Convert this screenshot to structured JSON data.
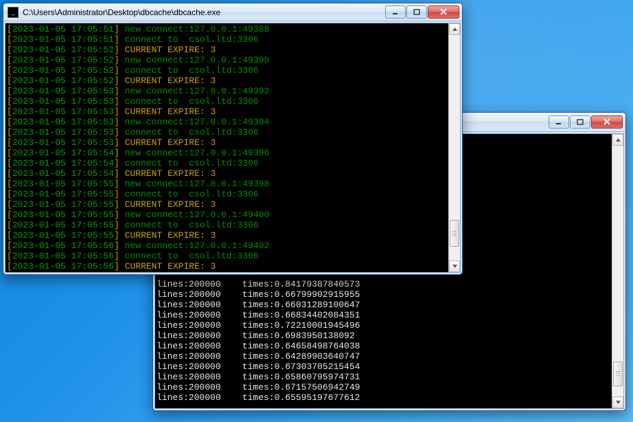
{
  "front_window": {
    "title": "C:\\Users\\Administrator\\Desktop\\dbcache\\dbcache.exe",
    "scroll": {
      "thumb_top_pct": 82,
      "thumb_height_pct": 12
    },
    "log": [
      {
        "ts": "2023-01-05 17:05:51",
        "msg": "new connect:127.0.0.1:49388",
        "style": "green"
      },
      {
        "ts": "2023-01-05 17:05:51",
        "msg": "connect to  csol.ltd:3306",
        "style": "green"
      },
      {
        "ts": "2023-01-05 17:05:52",
        "msg": "CURRENT EXPIRE: 3",
        "style": "yellow"
      },
      {
        "ts": "2023-01-05 17:05:52",
        "msg": "new connect:127.0.0.1:49390",
        "style": "green"
      },
      {
        "ts": "2023-01-05 17:05:52",
        "msg": "connect to  csol.ltd:3306",
        "style": "green"
      },
      {
        "ts": "2023-01-05 17:05:52",
        "msg": "CURRENT EXPIRE: 3",
        "style": "yellow"
      },
      {
        "ts": "2023-01-05 17:05:53",
        "msg": "new connect:127.0.0.1:49392",
        "style": "green"
      },
      {
        "ts": "2023-01-05 17:05:53",
        "msg": "connect to  csol.ltd:3306",
        "style": "green"
      },
      {
        "ts": "2023-01-05 17:05:53",
        "msg": "CURRENT EXPIRE: 3",
        "style": "yellow"
      },
      {
        "ts": "2023-01-05 17:05:53",
        "msg": "new connect:127.0.0.1:49394",
        "style": "green"
      },
      {
        "ts": "2023-01-05 17:05:53",
        "msg": "connect to  csol.ltd:3306",
        "style": "green"
      },
      {
        "ts": "2023-01-05 17:05:53",
        "msg": "CURRENT EXPIRE: 3",
        "style": "yellow"
      },
      {
        "ts": "2023-01-05 17:05:54",
        "msg": "new connect:127.0.0.1:49396",
        "style": "green"
      },
      {
        "ts": "2023-01-05 17:05:54",
        "msg": "connect to  csol.ltd:3306",
        "style": "green"
      },
      {
        "ts": "2023-01-05 17:05:54",
        "msg": "CURRENT EXPIRE: 3",
        "style": "yellow"
      },
      {
        "ts": "2023-01-05 17:05:55",
        "msg": "new connect:127.0.0.1:49398",
        "style": "green"
      },
      {
        "ts": "2023-01-05 17:05:55",
        "msg": "connect to  csol.ltd:3306",
        "style": "green"
      },
      {
        "ts": "2023-01-05 17:05:55",
        "msg": "CURRENT EXPIRE: 3",
        "style": "yellow"
      },
      {
        "ts": "2023-01-05 17:05:55",
        "msg": "new connect:127.0.0.1:49400",
        "style": "green"
      },
      {
        "ts": "2023-01-05 17:05:55",
        "msg": "connect to  csol.ltd:3306",
        "style": "green"
      },
      {
        "ts": "2023-01-05 17:05:55",
        "msg": "CURRENT EXPIRE: 3",
        "style": "yellow"
      },
      {
        "ts": "2023-01-05 17:05:56",
        "msg": "new connect:127.0.0.1:49402",
        "style": "green"
      },
      {
        "ts": "2023-01-05 17:05:56",
        "msg": "connect to  csol.ltd:3306",
        "style": "green"
      },
      {
        "ts": "2023-01-05 17:05:56",
        "msg": "CURRENT EXPIRE: 3",
        "style": "yellow"
      }
    ]
  },
  "back_window": {
    "title": "",
    "scroll": {
      "thumb_top_pct": 86,
      "thumb_height_pct": 10
    },
    "rows": [
      {
        "lines": "200000",
        "times": "0.84179387840573"
      },
      {
        "lines": "200000",
        "times": "0.66799902915955"
      },
      {
        "lines": "200000",
        "times": "0.66031289100647"
      },
      {
        "lines": "200000",
        "times": "0.66834402084351"
      },
      {
        "lines": "200000",
        "times": "0.72210001945496"
      },
      {
        "lines": "200000",
        "times": "0.6983950138092"
      },
      {
        "lines": "200000",
        "times": "0.64658498764038"
      },
      {
        "lines": "200000",
        "times": "0.64289903640747"
      },
      {
        "lines": "200000",
        "times": "0.67303705215454"
      },
      {
        "lines": "200000",
        "times": "0.65860795974731"
      },
      {
        "lines": "200000",
        "times": "0.67157506942749"
      },
      {
        "lines": "200000",
        "times": "0.65595197677612"
      }
    ]
  }
}
